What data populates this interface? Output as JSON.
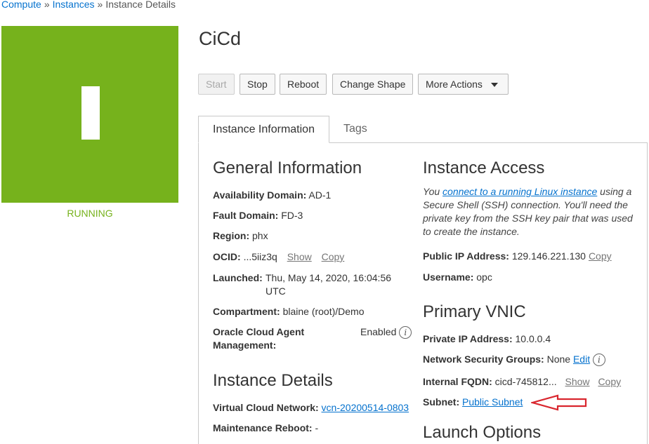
{
  "breadcrumb": {
    "items": [
      "Compute",
      "Instances",
      "Instance Details"
    ],
    "separator": "»"
  },
  "instance": {
    "name": "CiCd",
    "state": "RUNNING",
    "state_color": "#76b21c"
  },
  "toolbar": {
    "start_label": "Start",
    "stop_label": "Stop",
    "reboot_label": "Reboot",
    "change_shape_label": "Change Shape",
    "more_actions_label": "More Actions"
  },
  "tabs": [
    {
      "label": "Instance Information",
      "active": true
    },
    {
      "label": "Tags",
      "active": false
    }
  ],
  "general_information": {
    "heading": "General Information",
    "availability_domain": {
      "label": "Availability Domain:",
      "value": "AD-1"
    },
    "fault_domain": {
      "label": "Fault Domain:",
      "value": "FD-3"
    },
    "region": {
      "label": "Region:",
      "value": "phx"
    },
    "ocid": {
      "label": "OCID:",
      "value": "...5iiz3q",
      "show_label": "Show",
      "copy_label": "Copy"
    },
    "launched": {
      "label": "Launched:",
      "value_line1": "Thu, May 14, 2020, 16:04:56",
      "value_line2": "UTC"
    },
    "compartment": {
      "label": "Compartment:",
      "value": "blaine (root)/Demo"
    },
    "agent": {
      "label_line1": "Oracle Cloud Agent",
      "label_line2": "Management:",
      "value": "Enabled"
    }
  },
  "instance_details": {
    "heading": "Instance Details",
    "vcn": {
      "label": "Virtual Cloud Network:",
      "value": "vcn-20200514-0803"
    },
    "maintenance_reboot": {
      "label": "Maintenance Reboot:",
      "value": "-"
    }
  },
  "instance_access": {
    "heading": "Instance Access",
    "intro_prefix": "You ",
    "intro_link": "connect to a running Linux instance",
    "intro_suffix": " using a Secure Shell (SSH) connection. You'll need the private key from the SSH key pair that was used to create the instance.",
    "public_ip": {
      "label": "Public IP Address:",
      "value": "129.146.221.130",
      "copy_label": "Copy"
    },
    "username": {
      "label": "Username:",
      "value": "opc"
    }
  },
  "primary_vnic": {
    "heading": "Primary VNIC",
    "private_ip": {
      "label": "Private IP Address:",
      "value": "10.0.0.4"
    },
    "nsg": {
      "label": "Network Security Groups:",
      "value": "None",
      "edit_label": "Edit"
    },
    "fqdn": {
      "label": "Internal FQDN:",
      "value": "cicd-745812...",
      "show_label": "Show",
      "copy_label": "Copy"
    },
    "subnet": {
      "label": "Subnet:",
      "value": "Public Subnet"
    }
  },
  "launch_options": {
    "heading": "Launch Options"
  },
  "annotation": {
    "arrow_color": "#d9262e"
  }
}
